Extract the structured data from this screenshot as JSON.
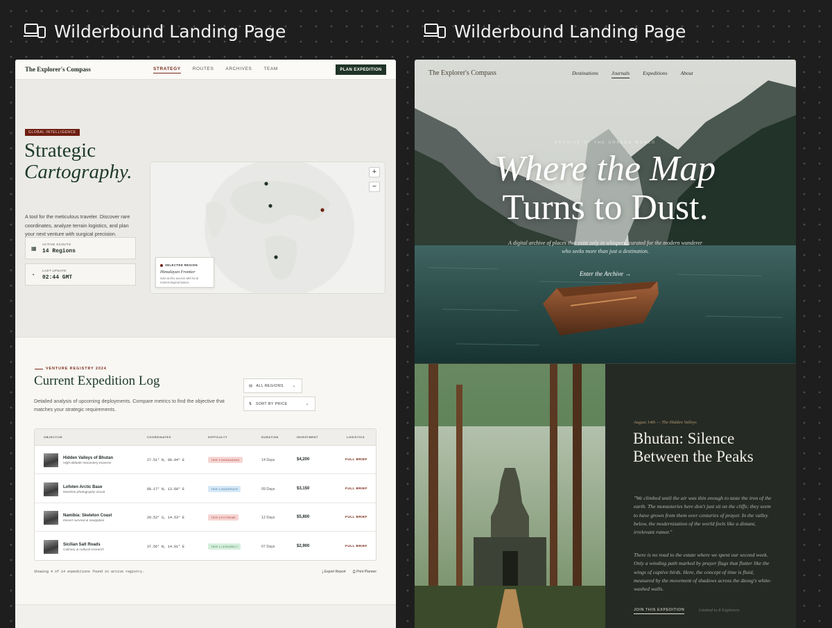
{
  "frames": {
    "left_label": "Wilderbound Landing Page",
    "right_label": "Wilderbound Landing Page"
  },
  "left": {
    "nav": {
      "brand": "The Explorer's Compass",
      "items": [
        "STRATEGY",
        "ROUTES",
        "ARCHIVES",
        "TEAM"
      ],
      "active": "STRATEGY",
      "cta": "PLAN EXPEDITION"
    },
    "hero": {
      "tag": "GLOBAL INTELLIGENCE",
      "title_line1": "Strategic",
      "title_line2": "Cartography.",
      "description": "A tool for the meticulous traveler. Discover rare coordinates, analyze terrain logistics, and plan your next venture with surgical precision.",
      "stats": [
        {
          "caption": "ACTIVE SCOUTS",
          "value": "14 Regions",
          "icon": "grid-icon"
        },
        {
          "caption": "LAST UPDATE",
          "value": "02:44 GMT",
          "icon": "clock-icon"
        }
      ],
      "map": {
        "zoom_in": "+",
        "zoom_out": "−",
        "popup_caption": "SELECTED REGION",
        "popup_name": "Himalayan Frontier",
        "popup_note": "Solo-archiv access with local meteorological basics."
      }
    },
    "registry": {
      "eyebrow": "VENTURE REGISTRY 2024",
      "title": "Current Expedition Log",
      "subtitle": "Detailed analysis of upcoming deployments. Compare metrics to find the objective that matches your strategic requirements.",
      "filter_region": "ALL REGIONS",
      "filter_sort": "SORT BY PRICE",
      "columns": [
        "OBJECTIVE",
        "COORDINATES",
        "DIFFICULTY",
        "DURATION",
        "INVESTMENT",
        "LOGISTICS"
      ],
      "rows": [
        {
          "name": "Hidden Valleys of Bhutan",
          "subtitle": "High-altitude monastery traverse",
          "coords": "27.51° N, 89.94° E",
          "tier": "TIER 4 DEMANDING",
          "tier_color": "#f6d5d3",
          "tier_text": "#a83a2f",
          "duration": "14 Days",
          "price": "$4,200",
          "action": "FULL BRIEF"
        },
        {
          "name": "Lofoten Arctic Base",
          "subtitle": "Maritime photography circuit",
          "coords": "68.17° N, 13.60° E",
          "tier": "TIER 2 MODERATE",
          "tier_color": "#d5e8f7",
          "tier_text": "#3a6f9a",
          "duration": "09 Days",
          "price": "$3,150",
          "action": "FULL BRIEF"
        },
        {
          "name": "Namibia: Skeleton Coast",
          "subtitle": "Desert survival & navigation",
          "coords": "20.53° S, 14.53° E",
          "tier": "TIER 5 EXTREME",
          "tier_color": "#f6d5d3",
          "tier_text": "#a83a2f",
          "duration": "12 Days",
          "price": "$5,800",
          "action": "FULL BRIEF"
        },
        {
          "name": "Sicilian Salt Roads",
          "subtitle": "Culinary & cultural research",
          "coords": "37.56° N, 14.01° E",
          "tier": "TIER 1 LEISURELY",
          "tier_color": "#d5efdc",
          "tier_text": "#3a7a4c",
          "duration": "07 Days",
          "price": "$2,900",
          "action": "FULL BRIEF"
        }
      ],
      "footer": "Showing 4 of 14 expeditions found in active registry.",
      "export": "Export Report",
      "print": "Print Planner"
    }
  },
  "right": {
    "nav": {
      "brand": "The Explorer's Compass",
      "items": [
        "Destinations",
        "Journals",
        "Expeditions",
        "About"
      ],
      "active": "Journals"
    },
    "hero": {
      "eyebrow": "ARCHIVE OF THE UNSEEN WORLD",
      "title_line1": "Where the Map",
      "title_line2": "Turns to Dust.",
      "subtitle": "A digital archive of places that exist only in whispers, curated for the modern wanderer who seeks more than just a destination.",
      "cta": "Enter the Archive",
      "cta_arrow": "→"
    },
    "story": {
      "meta": "August 14th — The Hidden Valleys",
      "title": "Bhutan: Silence Between the Peaks",
      "quote": "\"We climbed until the air was thin enough to taste the iron of the earth. The monasteries here don't just sit on the cliffs; they seem to have grown from them over centuries of prayer. In the valley below, the modernization of the world feels like a distant, irrelevant rumor.\"",
      "body": "There is no road to the estate where we spent our second week. Only a winding path marked by prayer flags that flutter like the wings of captive birds. Here, the concept of time is fluid, measured by the movement of shadows across the dzong's white-washed walls.",
      "join": "JOIN THIS EXPEDITION",
      "limit": "Limited to 8 Explorers"
    }
  }
}
